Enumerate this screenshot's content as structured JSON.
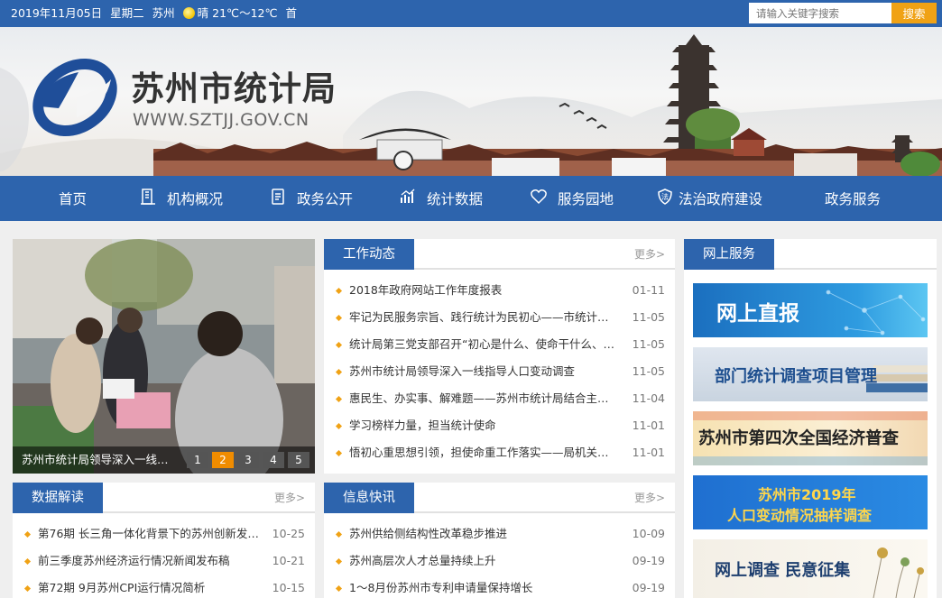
{
  "topbar": {
    "date": "2019年11月05日",
    "weekday": "星期二",
    "city": "苏州",
    "weather": "晴 21℃～12℃",
    "more": "首",
    "search_placeholder": "请输入关键字搜索",
    "search_button": "搜索"
  },
  "header": {
    "title": "苏州市统计局",
    "url": "WWW.SZTJJ.GOV.CN"
  },
  "nav": [
    {
      "label": "首页",
      "icon": "home"
    },
    {
      "label": "机构概况",
      "icon": "building-icon"
    },
    {
      "label": "政务公开",
      "icon": "document-icon"
    },
    {
      "label": "统计数据",
      "icon": "chart-icon"
    },
    {
      "label": "服务园地",
      "icon": "heart-icon"
    },
    {
      "label": "法治政府建设",
      "icon": "law-shield-icon"
    },
    {
      "label": "政务服务",
      "icon": ""
    }
  ],
  "slider": {
    "caption": "苏州市统计局领导深入一线…",
    "pages": [
      "1",
      "2",
      "3",
      "4",
      "5"
    ],
    "active_page": "2"
  },
  "work_news": {
    "title": "工作动态",
    "more": "更多>",
    "items": [
      {
        "title": "2018年政府网站工作年度报表",
        "date": "01-11"
      },
      {
        "title": "牢记为民服务宗旨、践行统计为民初心——市统计局党…",
        "date": "11-05"
      },
      {
        "title": "统计局第三党支部召开“初心是什么、使命干什么、奋…",
        "date": "11-05"
      },
      {
        "title": "苏州市统计局领导深入一线指导人口变动调查",
        "date": "11-05"
      },
      {
        "title": "惠民生、办实事、解难题——苏州市统计局结合主题教…",
        "date": "11-04"
      },
      {
        "title": "学习榜样力量，担当统计使命",
        "date": "11-01"
      },
      {
        "title": "悟初心重思想引领，担使命重工作落实——局机关党委…",
        "date": "11-01"
      }
    ]
  },
  "online_service": {
    "title": "网上服务",
    "items": [
      {
        "label": "网上直报"
      },
      {
        "label": "部门统计调查项目管理"
      },
      {
        "label": "苏州市第四次全国经济普查"
      },
      {
        "label1": "苏州市2019年",
        "label2": "人口变动情况抽样调查"
      },
      {
        "label": "网上调查 民意征集"
      }
    ]
  },
  "data_analysis": {
    "title": "数据解读",
    "more": "更多>",
    "items": [
      {
        "title": "第76期 长三角一体化背景下的苏州创新发展…",
        "date": "10-25"
      },
      {
        "title": "前三季度苏州经济运行情况新闻发布稿",
        "date": "10-21"
      },
      {
        "title": "第72期 9月苏州CPI运行情况简析",
        "date": "10-15"
      }
    ]
  },
  "info_news": {
    "title": "信息快讯",
    "more": "更多>",
    "items": [
      {
        "title": "苏州供给侧结构性改革稳步推进",
        "date": "10-09"
      },
      {
        "title": "苏州高层次人才总量持续上升",
        "date": "09-19"
      },
      {
        "title": "1～8月份苏州市专利申请量保持增长",
        "date": "09-19"
      }
    ]
  },
  "colors": {
    "primary": "#2d64ad",
    "accent": "#f0a215",
    "page_active": "#f08c00"
  }
}
